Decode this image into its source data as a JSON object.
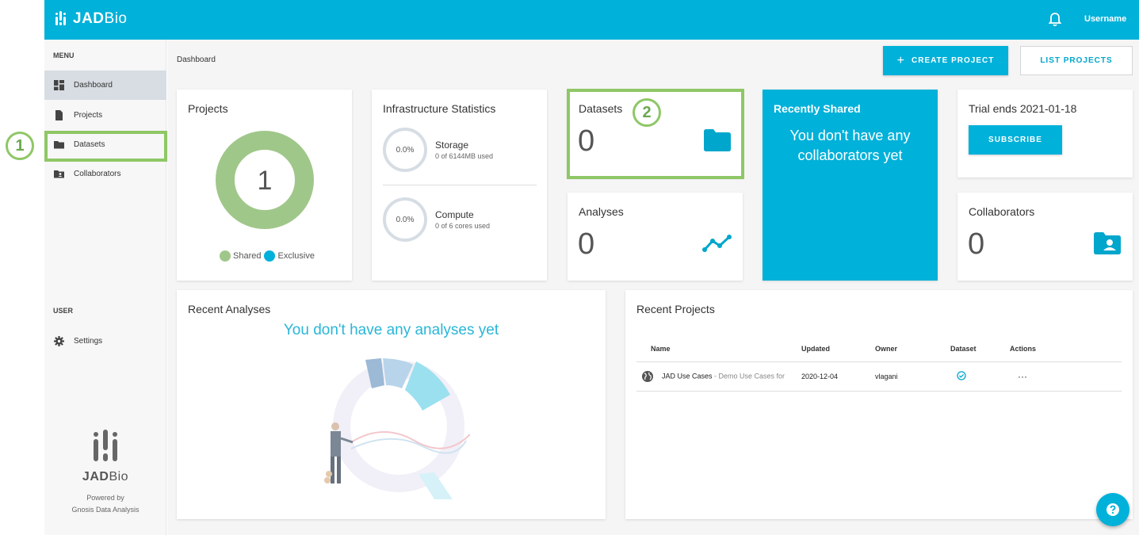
{
  "header": {
    "brand_bold": "JAD",
    "brand_light": "Bio",
    "username": "Username"
  },
  "sidebar": {
    "menu_label": "MENU",
    "items": [
      {
        "label": "Dashboard",
        "icon": "dashboard-icon",
        "active": true
      },
      {
        "label": "Projects",
        "icon": "document-icon"
      },
      {
        "label": "Datasets",
        "icon": "folder-icon"
      },
      {
        "label": "Collaborators",
        "icon": "shared-folder-icon"
      }
    ],
    "user_label": "USER",
    "settings_label": "Settings",
    "brand_bold": "JAD",
    "brand_light": "Bio",
    "powered_line1": "Powered by",
    "powered_line2": "Gnosis Data Analysis"
  },
  "breadcrumb": "Dashboard",
  "actions": {
    "create_project": "CREATE PROJECT",
    "list_projects": "LIST PROJECTS"
  },
  "cards": {
    "projects": {
      "title": "Projects",
      "count": "1",
      "legend_shared": "Shared",
      "legend_exclusive": "Exclusive",
      "shared_fraction": 1.0
    },
    "infra": {
      "title": "Infrastructure Statistics",
      "storage": {
        "percent": "0.0%",
        "label": "Storage",
        "detail": "0 of 6144MB used"
      },
      "compute": {
        "percent": "0.0%",
        "label": "Compute",
        "detail": "0 of 6 cores used"
      }
    },
    "datasets": {
      "title": "Datasets",
      "count": "0"
    },
    "analyses": {
      "title": "Analyses",
      "count": "0"
    },
    "recently_shared": {
      "title": "Recently Shared",
      "message": "You don't have any collaborators yet"
    },
    "trial": {
      "title": "Trial ends 2021-01-18",
      "button": "SUBSCRIBE"
    },
    "collaborators": {
      "title": "Collaborators",
      "count": "0"
    },
    "recent_analyses": {
      "title": "Recent Analyses",
      "message": "You don't have any analyses yet"
    },
    "recent_projects": {
      "title": "Recent Projects",
      "columns": [
        "Name",
        "Updated",
        "Owner",
        "Dataset",
        "Actions"
      ],
      "rows": [
        {
          "name": "JAD Use Cases",
          "description": " - Demo Use Cases for",
          "updated": "2020-12-04",
          "owner": "vlagani",
          "dataset_status": "check-circle-icon",
          "actions": "···"
        }
      ]
    }
  },
  "annotations": {
    "callout_1": "1",
    "callout_2": "2",
    "color": "#8fc766"
  },
  "colors": {
    "accent": "#00b1d9",
    "shared": "#a0c78a",
    "exclusive": "#00b1d9",
    "annotation": "#8fc766"
  }
}
